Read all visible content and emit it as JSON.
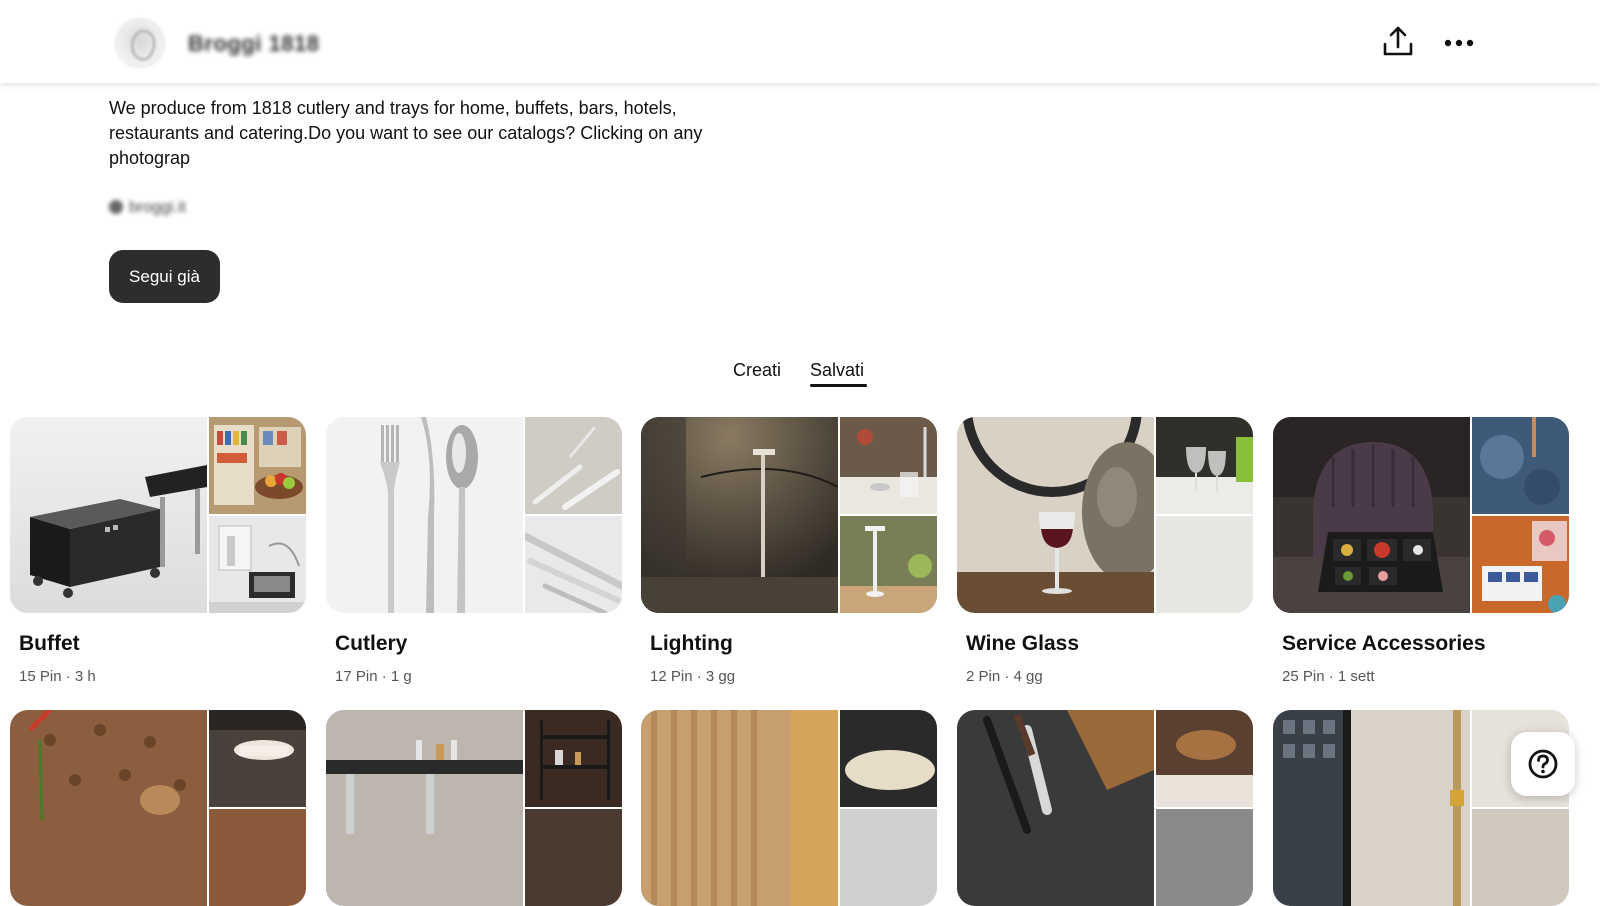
{
  "header": {
    "profile_name": "Broggi 1818",
    "share_icon": "share-upload-icon",
    "more_icon": "more-horizontal-icon"
  },
  "profile": {
    "bio": "We produce from 1818 cutlery and trays for home, buffets, bars, hotels, restaurants and catering.Do you want to see our catalogs? Clicking on any photograp",
    "website": "broggi.it",
    "follow_label": "Segui già"
  },
  "tabs": {
    "created_label": "Creati",
    "saved_label": "Salvati",
    "active": "saved"
  },
  "boards": [
    {
      "title": "Buffet",
      "meta": "15 Pin · 3 h"
    },
    {
      "title": "Cutlery",
      "meta": "17 Pin · 1 g"
    },
    {
      "title": "Lighting",
      "meta": "12 Pin · 3 gg"
    },
    {
      "title": "Wine Glass",
      "meta": "2 Pin · 4 gg"
    },
    {
      "title": "Service Accessories",
      "meta": "25 Pin · 1 sett"
    }
  ],
  "help": {
    "icon": "help-question-icon"
  }
}
